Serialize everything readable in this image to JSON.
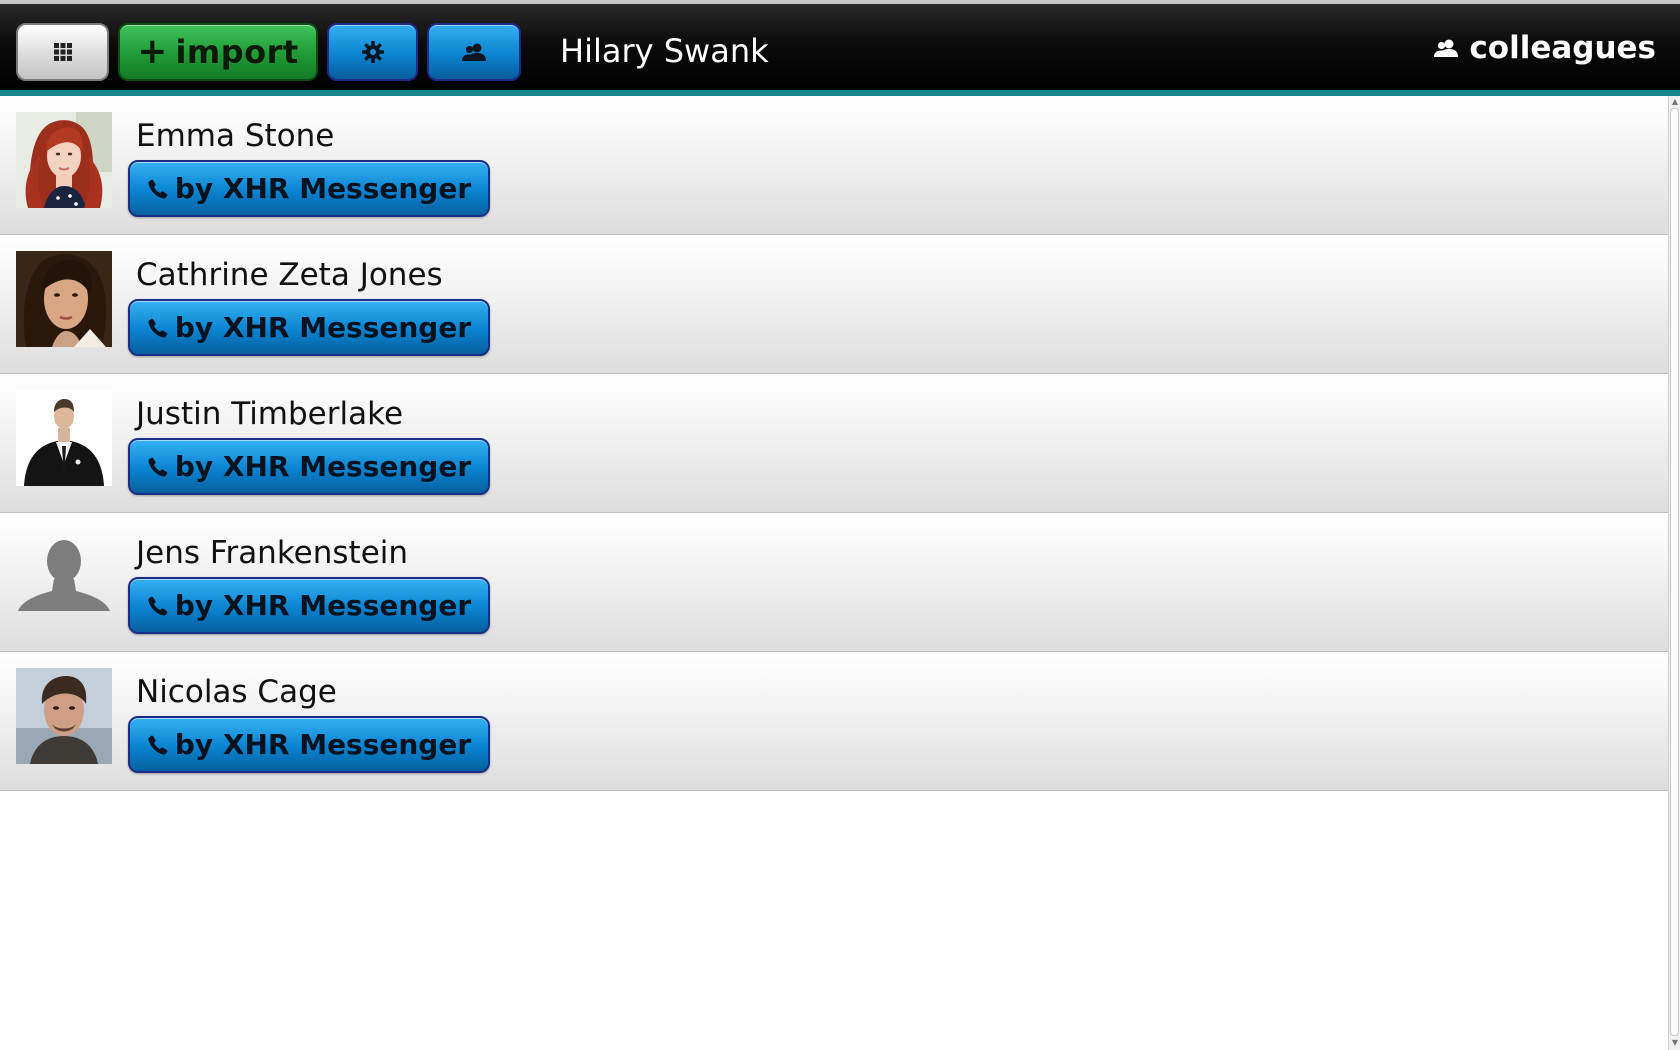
{
  "header": {
    "apps_icon": "grid-icon",
    "import_label": "import",
    "settings_icon": "gear-icon",
    "contacts_icon": "people-icon",
    "current_user": "Hilary Swank",
    "section_title": "colleagues",
    "section_icon": "people-icon"
  },
  "colors": {
    "header_bg": "#000000",
    "header_accent": "#15868c",
    "import_green": "#1f9a34",
    "button_blue": "#0b83cf"
  },
  "contacts": [
    {
      "name": "Emma Stone",
      "call_label": "by XHR Messenger",
      "avatar": "photo-red-hair-woman"
    },
    {
      "name": "Cathrine Zeta Jones",
      "call_label": "by XHR Messenger",
      "avatar": "photo-dark-hair-woman"
    },
    {
      "name": "Justin Timberlake",
      "call_label": "by XHR Messenger",
      "avatar": "photo-man-in-suit"
    },
    {
      "name": "Jens Frankenstein",
      "call_label": "by XHR Messenger",
      "avatar": "default-silhouette"
    },
    {
      "name": "Nicolas Cage",
      "call_label": "by XHR Messenger",
      "avatar": "photo-man-portrait"
    }
  ]
}
